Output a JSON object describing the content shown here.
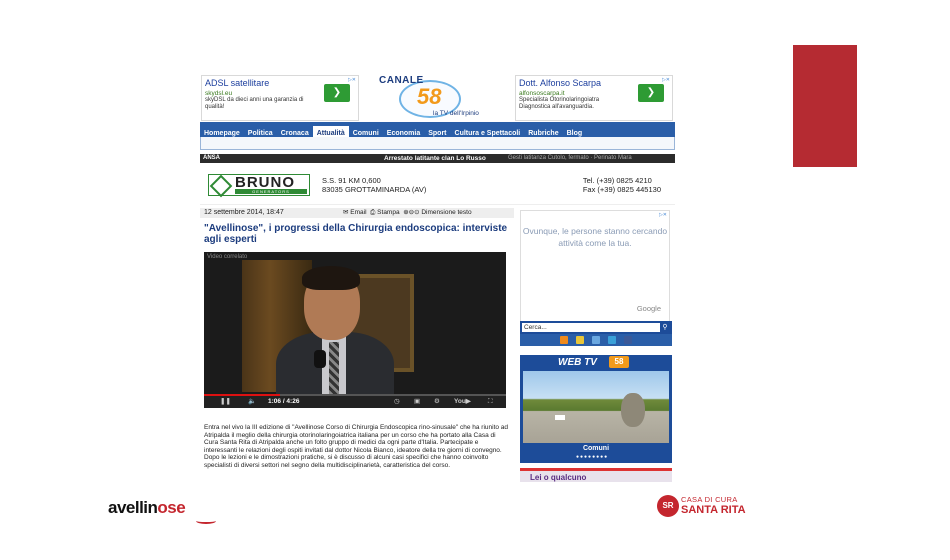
{
  "colors": {
    "accent_red": "#b52b32",
    "nav_blue": "#2a5ea8",
    "title_blue": "#1c3c7e"
  },
  "ads": {
    "left": {
      "title": "ADSL satellitare",
      "url": "skydsl.eu",
      "desc": "skyDSL da dieci anni una garanzia di qualità!"
    },
    "right": {
      "title": "Dott. Alfonso Scarpa",
      "url": "alfonsoscarpa.it",
      "desc": "Specialista Otorinolaringoiatra Diagnostica all'avanguardia."
    }
  },
  "site_logo": {
    "name": "CANALE",
    "number": "58",
    "tagline": "la TV dell'Irpinio"
  },
  "nav": [
    "Homepage",
    "Politica",
    "Cronaca",
    "Attualità",
    "Comuni",
    "Economia",
    "Sport",
    "Cultura e Spettacoli",
    "Rubriche",
    "Blog"
  ],
  "ansa": {
    "logo": "ANSA",
    "headline": "Arrestato latitante clan Lo Russo",
    "more": "Gesti latitanza Cutolo, fermato · Perinato Mara"
  },
  "bruno_ad": {
    "brand": "BRUNO",
    "sub": "GENERATORS",
    "addr1": "S.S. 91 KM 0,600",
    "addr2": "83035 GROTTAMINARDA (AV)",
    "tel": "Tel. (+39) 0825 4210",
    "fax": "Fax (+39) 0825 445130"
  },
  "article": {
    "date": "12 settembre 2014, 18:47",
    "email": "Email",
    "print": "Stampa",
    "textsize": "Dimensione testo",
    "title": "\"Avellinose\", i progressi della Chirurgia endoscopica: interviste agli esperti",
    "video_label": "Video correlato",
    "time": "1:06 / 4:26",
    "body": "Entra nel vivo la III edizione di \"Avellinose Corso di Chirurgia Endoscopica rino-sinusale\" che ha riunito ad Atripalda il meglio della chirurgia otorinolaringoiatrica italiana per un corso che ha portato alla Casa di Cura Santa Rita di Atripalda anche un folto gruppo di medici da ogni parte d'Italia. Partecipate e interessanti le relazioni degli ospiti invitati dal dottor Nicola Bianco, ideatore della tre giorni di convegno. Dopo le lezioni e le dimostrazioni pratiche, si è discusso di alcuni casi specifici che hanno coinvolto specialisti di diversi settori nel segno della multidisciplinarietà, caratteristica del corso.",
    "progress_fraction": 0.25
  },
  "sidebar": {
    "google_ad_text": "Ovunque, le persone stanno cercando attività come la tua.",
    "google": "Google",
    "search_placeholder": "Cerca...",
    "webtv_title": "WEB TV",
    "webtv_badge": "58",
    "webtv_caption": "Comuni",
    "promo": "Lei o qualcuno"
  },
  "logos": {
    "avellinose_a": "avellin",
    "avellinose_b": "ose",
    "casa_line1": "CASA DI CURA",
    "casa_line2": "SANTA RITA",
    "casa_mark": "SR"
  }
}
